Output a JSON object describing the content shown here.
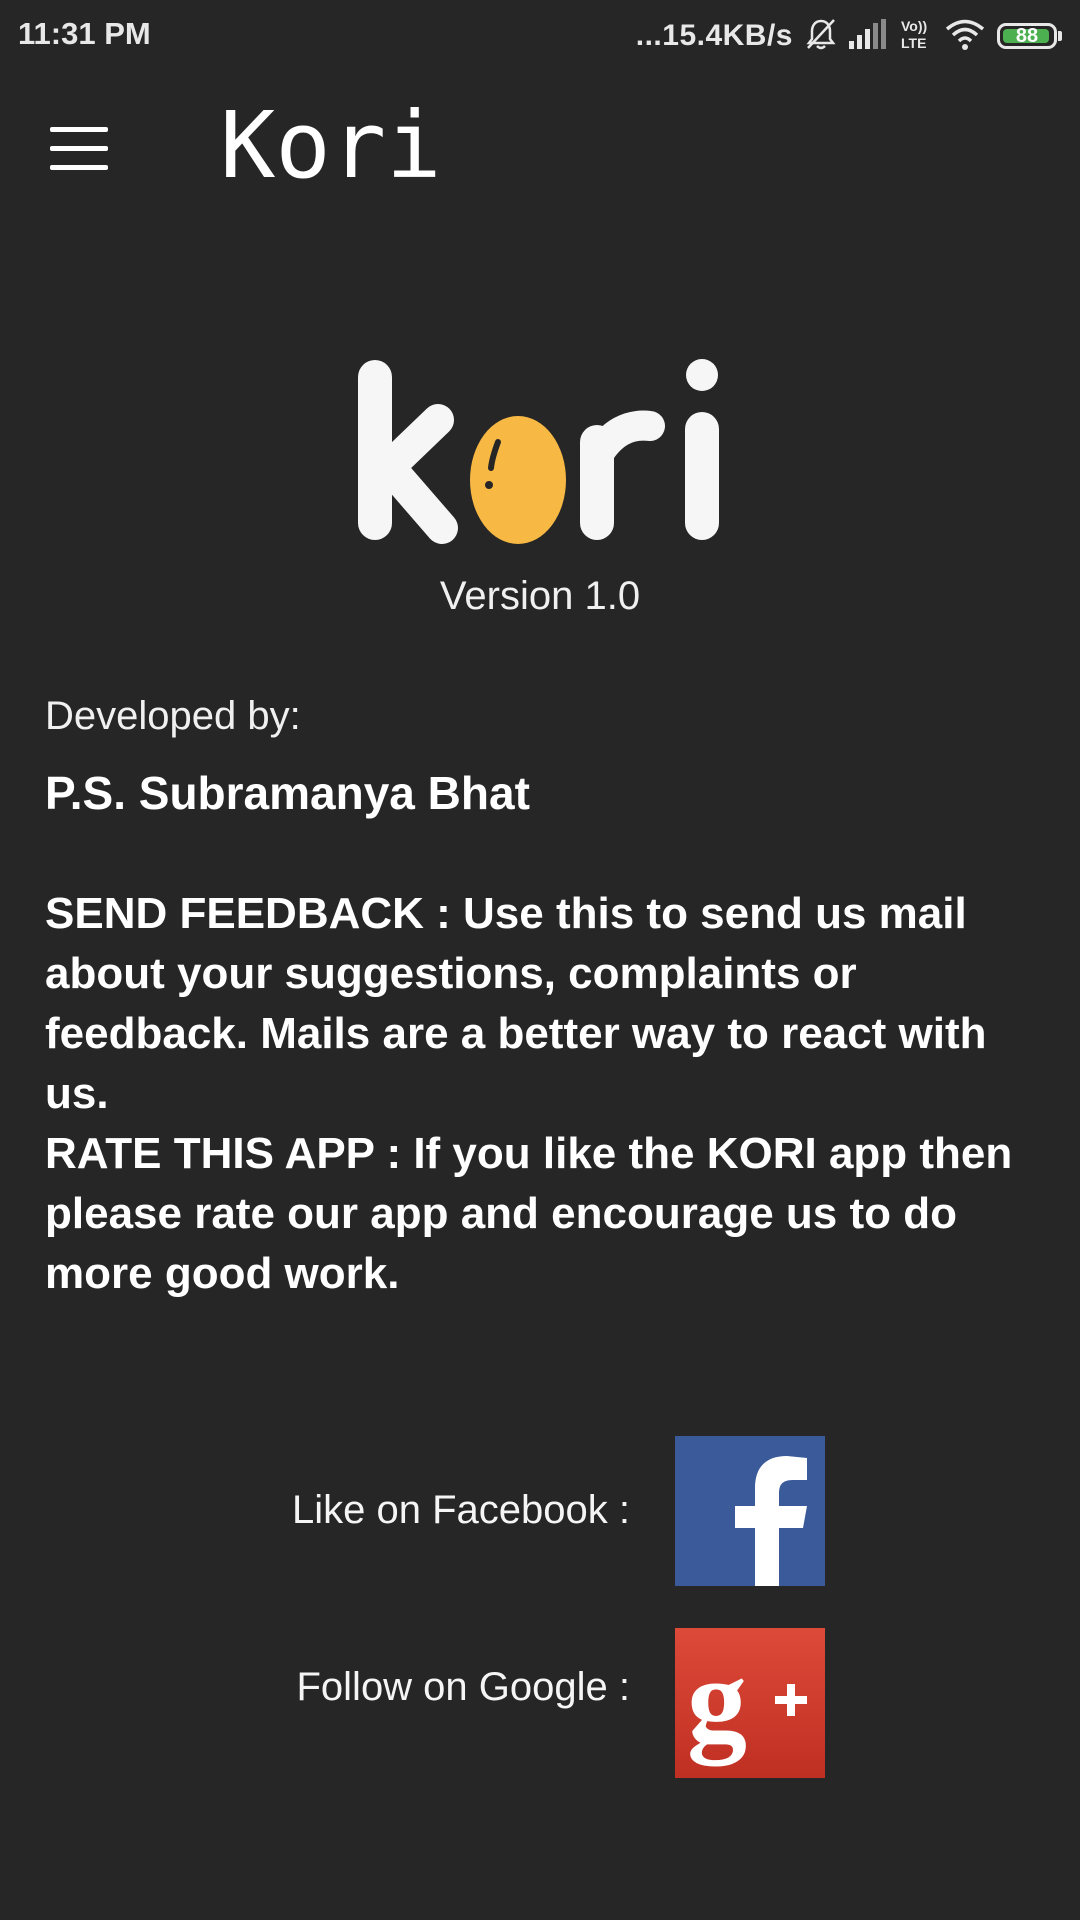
{
  "status_bar": {
    "time": "11:31 PM",
    "network_speed": "...15.4KB/s",
    "volte": "Vo)) LTE",
    "battery_level": "88",
    "icons": [
      "bell-off-icon",
      "signal-icon",
      "volte-icon",
      "wifi-icon",
      "battery-icon"
    ]
  },
  "app_bar": {
    "title": "Kori",
    "menu_icon": "menu-icon"
  },
  "logo": {
    "text": "kori",
    "accent_color": "#f7b844"
  },
  "version": "Version 1.0",
  "developer": {
    "label": "Developed by:",
    "name": "P.S. Subramanya Bhat"
  },
  "info": {
    "send_feedback": "SEND FEEDBACK : Use this to send us mail about your suggestions, complaints or feedback. Mails are a better way to react with us.",
    "rate_app": "RATE THIS APP : If you like the KORI app then please rate our app and encourage us to do more good work."
  },
  "social": {
    "facebook_label": "Like on Facebook :",
    "google_label": "Follow on Google :",
    "facebook_color": "#3b5a9a",
    "google_color": "#d23f31"
  },
  "colors": {
    "background": "#262626",
    "text": "#ffffff"
  }
}
